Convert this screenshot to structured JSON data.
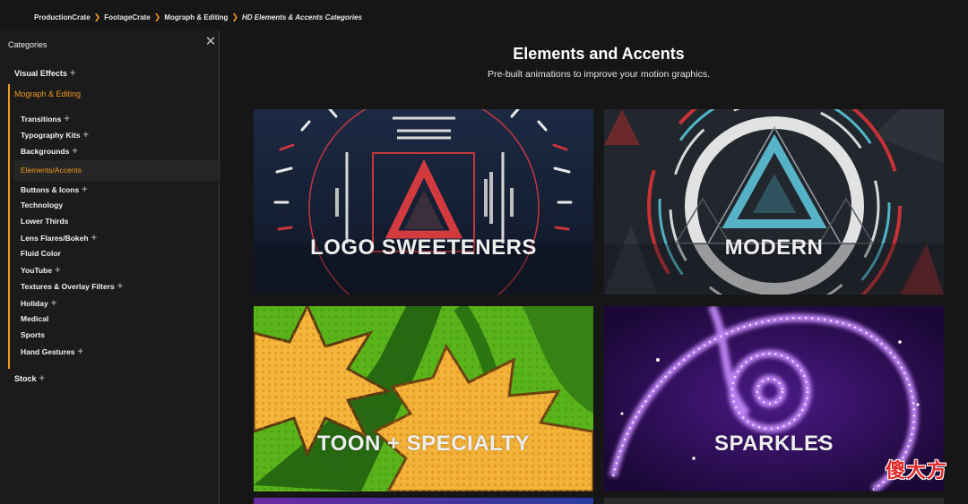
{
  "breadcrumb": {
    "items": [
      "ProductionCrate",
      "FootageCrate",
      "Mograph & Editing"
    ],
    "current": "HD Elements & Accents Categories"
  },
  "sidebar": {
    "header": "Categories",
    "close_icon": "close-icon",
    "categories": [
      {
        "label": "Visual Effects",
        "expandable": true
      },
      {
        "label": "Mograph & Editing",
        "expandable": false,
        "active": true
      },
      {
        "label": "Stock",
        "expandable": true
      }
    ],
    "subcategories": [
      {
        "label": "Transitions",
        "expandable": true
      },
      {
        "label": "Typography Kits",
        "expandable": true
      },
      {
        "label": "Backgrounds",
        "expandable": true
      },
      {
        "label": "Elements/Accents",
        "expandable": false,
        "active": true
      },
      {
        "label": "Buttons & Icons",
        "expandable": true
      },
      {
        "label": "Technology",
        "expandable": false
      },
      {
        "label": "Lower Thirds",
        "expandable": false
      },
      {
        "label": "Lens Flares/Bokeh",
        "expandable": true
      },
      {
        "label": "Fluid Color",
        "expandable": false
      },
      {
        "label": "YouTube",
        "expandable": true
      },
      {
        "label": "Textures & Overlay Filters",
        "expandable": true
      },
      {
        "label": "Holiday",
        "expandable": true
      },
      {
        "label": "Medical",
        "expandable": false
      },
      {
        "label": "Sports",
        "expandable": false
      },
      {
        "label": "Hand Gestures",
        "expandable": true
      }
    ],
    "plus_symbol": "+"
  },
  "main": {
    "title": "Elements and Accents",
    "subtitle": "Pre-built animations to improve your motion graphics.",
    "cards": [
      {
        "label": "LOGO SWEETENERS"
      },
      {
        "label": "MODERN"
      },
      {
        "label": "TOON + SPECIALTY"
      },
      {
        "label": "SPARKLES"
      }
    ]
  },
  "watermark": "傻大方",
  "colors": {
    "accent": "#f29a1d",
    "background": "#161616",
    "sidebar": "#1b1b1b"
  }
}
